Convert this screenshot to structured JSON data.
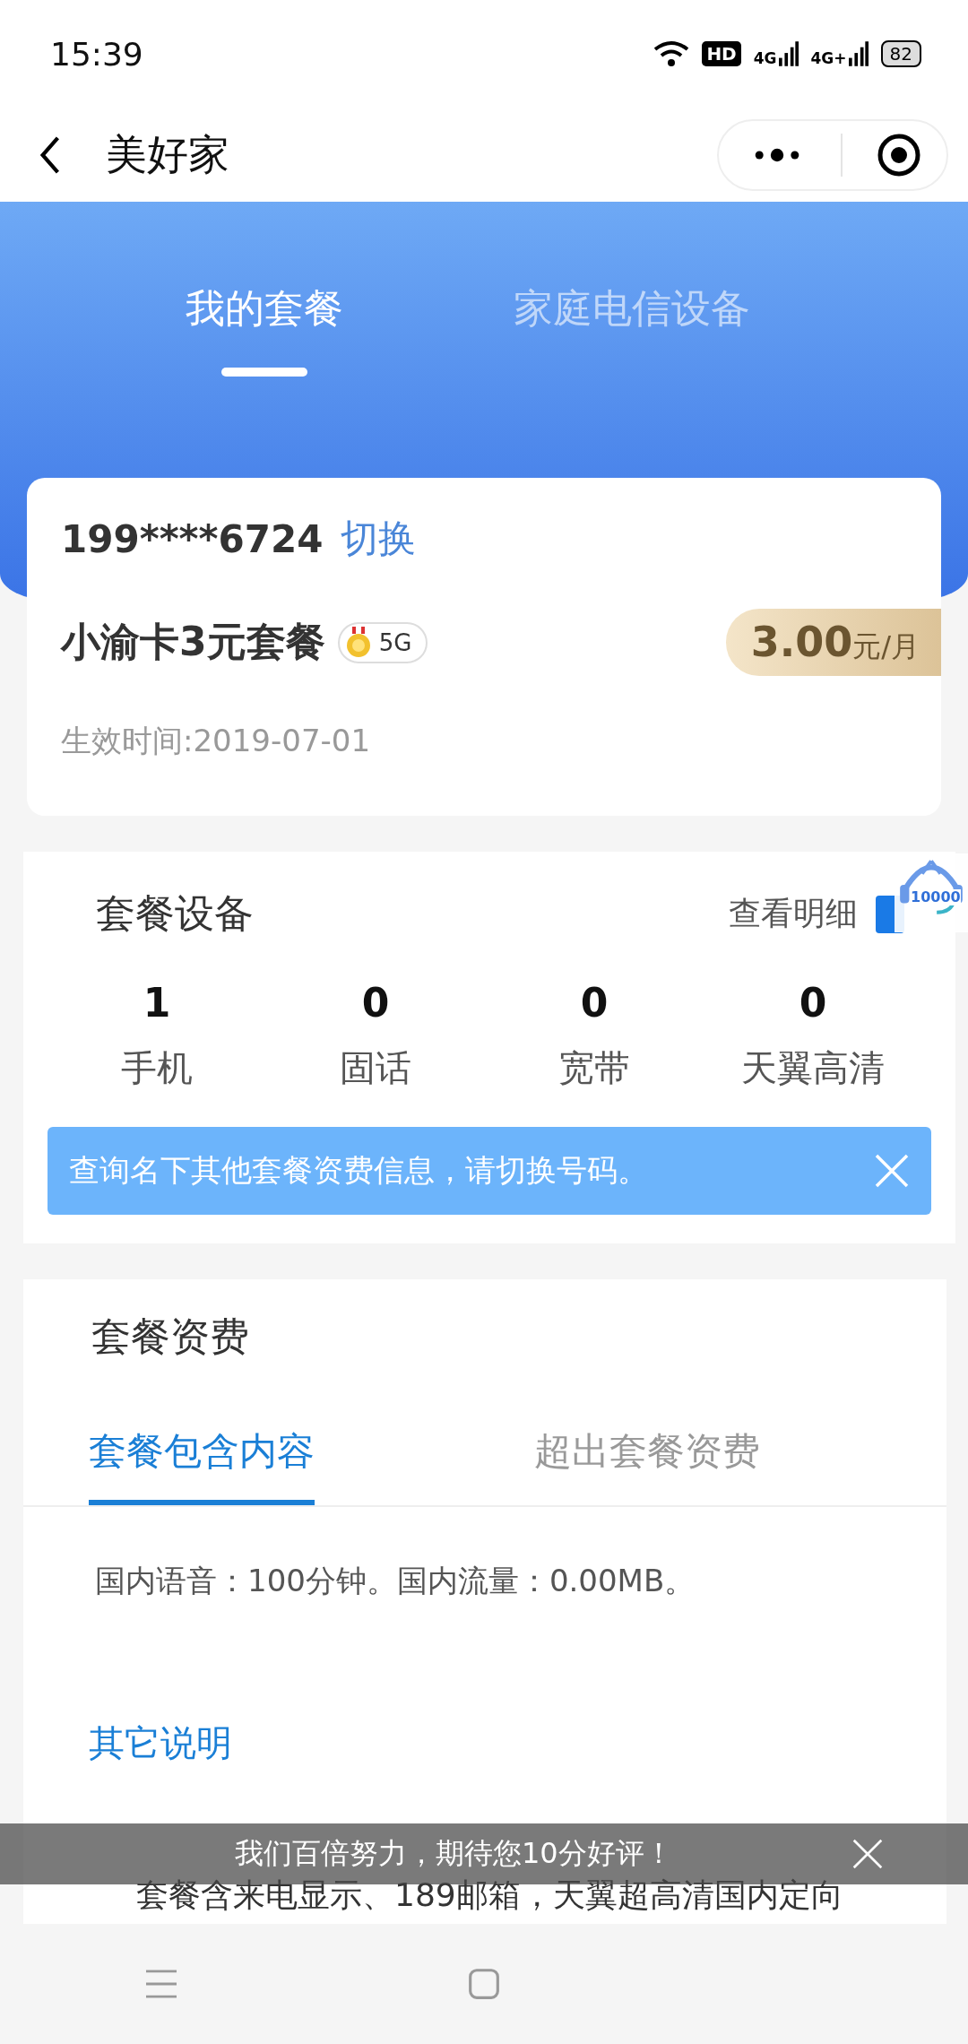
{
  "status_bar": {
    "time": "15:39",
    "network_labels": [
      "HD",
      "4G",
      "4G+"
    ],
    "battery": "82"
  },
  "nav": {
    "title": "美好家"
  },
  "tabs": [
    {
      "label": "我的套餐",
      "selected": true
    },
    {
      "label": "家庭电信设备",
      "selected": false
    }
  ],
  "plan_card": {
    "phone": "199****6724",
    "switch_link": "切换",
    "plan_name": "小渝卡3元套餐",
    "badge": "5G",
    "price": "3.00",
    "price_unit": "元/月",
    "effective": "生效时间:2019-07-01"
  },
  "devices": {
    "title": "套餐设备",
    "detail_link": "查看明细",
    "support_badge": "10000",
    "stats": [
      {
        "count": "1",
        "label": "手机"
      },
      {
        "count": "0",
        "label": "固话"
      },
      {
        "count": "0",
        "label": "宽带"
      },
      {
        "count": "0",
        "label": "天翼高清"
      }
    ],
    "notice": "查询名下其他套餐资费信息，请切换号码。"
  },
  "fees": {
    "title": "套餐资费",
    "tabs": [
      {
        "label": "套餐包含内容",
        "selected": true
      },
      {
        "label": "超出套餐资费",
        "selected": false
      }
    ],
    "content": "国内语音：100分钟。国内流量：0.00MB。",
    "other_title": "其它说明",
    "other_text": "套餐含来电显示、189邮箱，天翼超高清国内定向"
  },
  "toast": {
    "text": "我们百倍努力，期待您10分好评！"
  }
}
